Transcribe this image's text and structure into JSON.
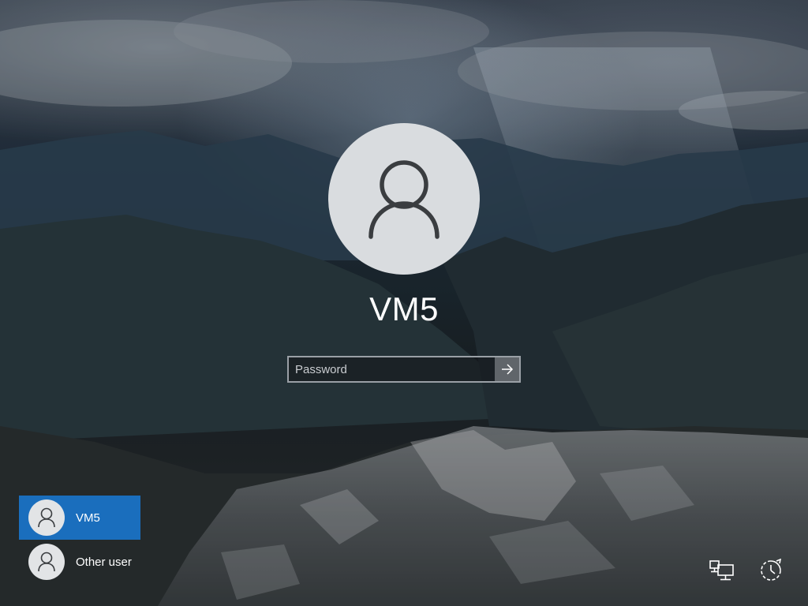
{
  "login": {
    "username": "VM5",
    "password_placeholder": "Password",
    "password_value": ""
  },
  "users": [
    {
      "name": "VM5",
      "selected": true
    },
    {
      "name": "Other user",
      "selected": false
    }
  ],
  "icons": {
    "avatar": "user-silhouette-icon",
    "submit": "arrow-right-icon",
    "network": "network-icon",
    "ease_of_access": "ease-of-access-icon",
    "power": "power-icon"
  },
  "colors": {
    "selected_tile": "#1a6ebd",
    "avatar_bg": "#d9dcdf"
  }
}
